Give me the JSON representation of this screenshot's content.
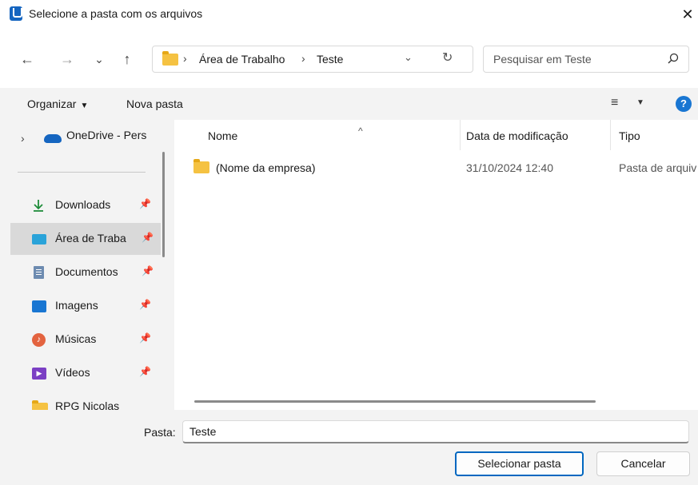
{
  "window": {
    "title": "Selecione a pasta com os arquivos",
    "close_glyph": "✕"
  },
  "nav": {
    "back_glyph": "←",
    "forward_glyph": "→",
    "recent_glyph": "⌄",
    "up_glyph": "↑",
    "breadcrumb": [
      "Área de Trabalho",
      "Teste"
    ],
    "breadcrumb_sep": "›",
    "dropdown_glyph": "⌄",
    "refresh_glyph": "↻",
    "search_placeholder": "Pesquisar em Teste"
  },
  "toolbar": {
    "organize_label": "Organizar",
    "new_folder_label": "Nova pasta",
    "view_glyph": "≡",
    "help_glyph": "?"
  },
  "sidebar": {
    "onedrive_label": "OneDrive - Pers",
    "items": [
      {
        "label": "Downloads",
        "icon": "download-icon"
      },
      {
        "label": "Área de Traba",
        "icon": "desktop-icon",
        "selected": true
      },
      {
        "label": "Documentos",
        "icon": "documents-icon"
      },
      {
        "label": "Imagens",
        "icon": "pictures-icon"
      },
      {
        "label": "Músicas",
        "icon": "music-icon"
      },
      {
        "label": "Vídeos",
        "icon": "videos-icon"
      },
      {
        "label": "RPG Nicolas",
        "icon": "folder-icon"
      }
    ]
  },
  "table": {
    "columns": [
      "Nome",
      "Data de modificação",
      "Tipo"
    ],
    "rows": [
      {
        "name": "(Nome da empresa)",
        "date": "31/10/2024 12:40",
        "type": "Pasta de arquiv"
      }
    ]
  },
  "footer": {
    "folder_label": "Pasta:",
    "folder_value": "Teste",
    "select_button": "Selecionar pasta",
    "cancel_button": "Cancelar"
  },
  "colors": {
    "accent": "#0067c0",
    "folder": "#f5c242",
    "selected_bg": "#d9d9d9",
    "onedrive": "#1565c0"
  }
}
